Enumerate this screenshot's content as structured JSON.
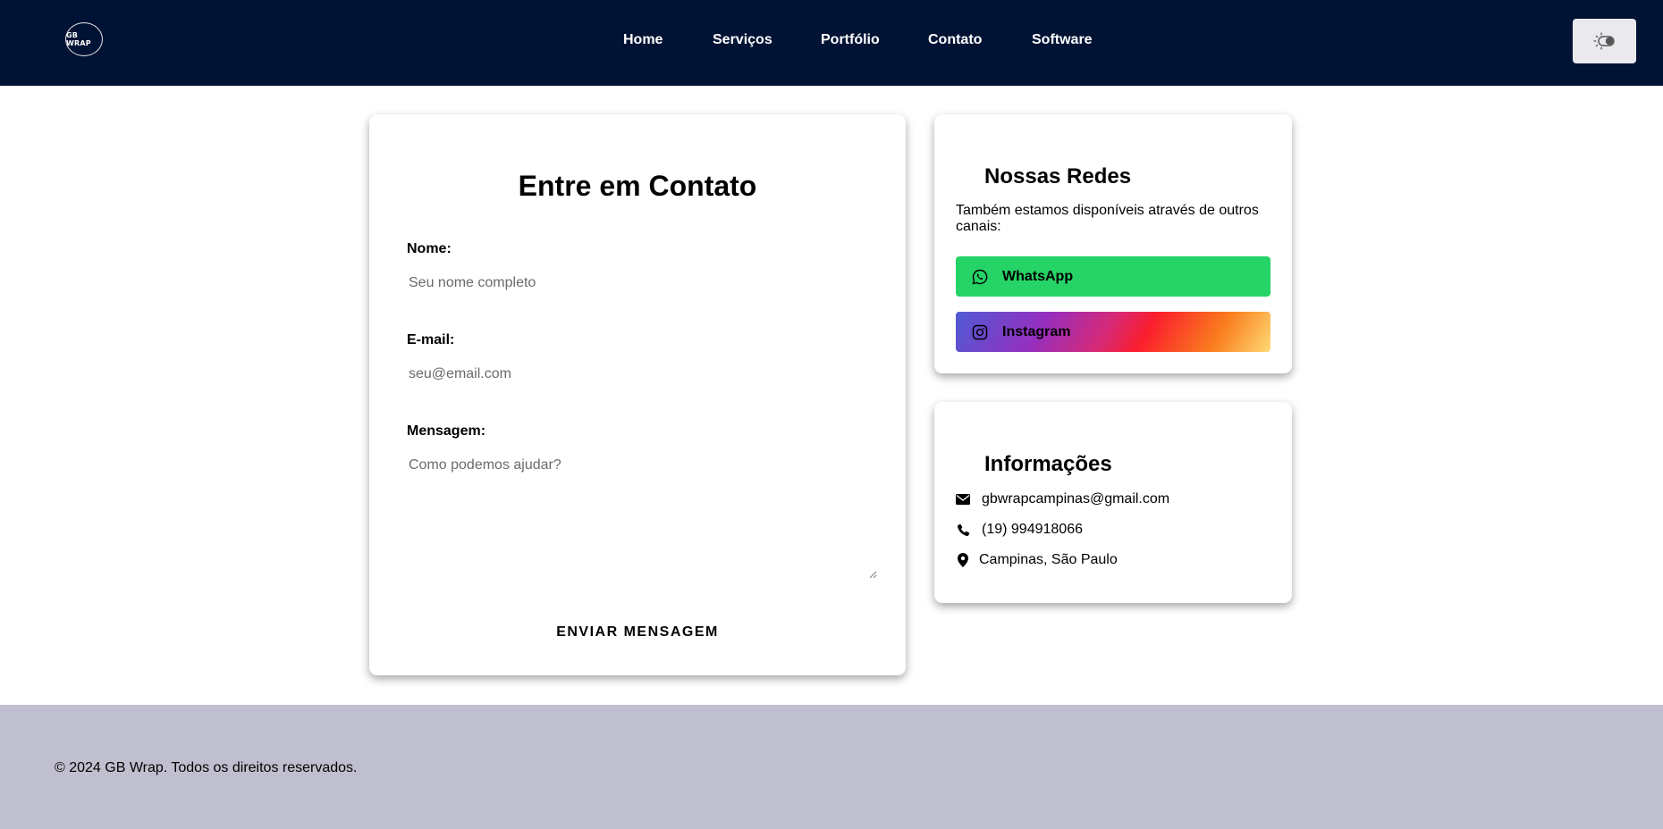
{
  "header": {
    "logo_text": "GB WRAP",
    "nav": [
      {
        "label": "Home"
      },
      {
        "label": "Serviços"
      },
      {
        "label": "Portfólio"
      },
      {
        "label": "Contato"
      },
      {
        "label": "Software"
      }
    ],
    "theme_toggle_icon": "sun-moon-toggle-icon"
  },
  "contact_form": {
    "title": "Entre em Contato",
    "name_label": "Nome:",
    "name_placeholder": "Seu nome completo",
    "email_label": "E-mail:",
    "email_placeholder": "seu@email.com",
    "message_label": "Mensagem:",
    "message_placeholder": "Como podemos ajudar?",
    "submit_label": "ENVIAR MENSAGEM"
  },
  "redes": {
    "title": "Nossas Redes",
    "description": "Também estamos disponíveis através de outros canais:",
    "whatsapp_label": "WhatsApp",
    "instagram_label": "Instagram",
    "whatsapp_color": "#25d366"
  },
  "info": {
    "title": "Informações",
    "email": "gbwrapcampinas@gmail.com",
    "phone": "(19) 994918066",
    "location": "Campinas, São Paulo"
  },
  "footer": {
    "copyright": "© 2024 GB Wrap. Todos os direitos reservados."
  },
  "colors": {
    "header_bg": "#011334",
    "footer_bg": "#c0bfcf"
  }
}
